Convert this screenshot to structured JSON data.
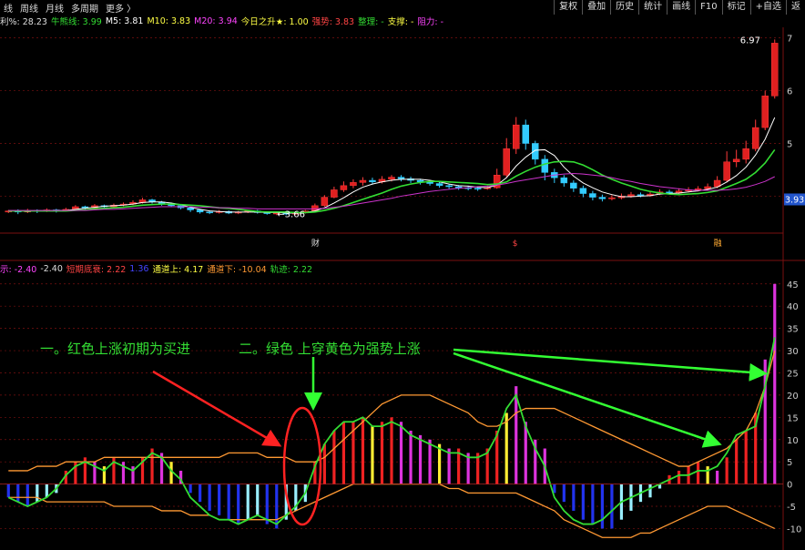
{
  "tabs": [
    "线",
    "周线",
    "月线",
    "多周期",
    "更多 〉"
  ],
  "toolbar": [
    "复权",
    "叠加",
    "历史",
    "统计",
    "画线",
    "F10",
    "标记",
    "+自选",
    "返"
  ],
  "info_main": [
    {
      "label": "利%: ",
      "value": "28.23",
      "color": "#dddddd"
    },
    {
      "label": "牛熊线: ",
      "value": "3.99",
      "color": "#33dd33"
    },
    {
      "label": "M5: ",
      "value": "3.81",
      "color": "#ffffff"
    },
    {
      "label": "M10: ",
      "value": "3.83",
      "color": "#ffff44"
    },
    {
      "label": "M20: ",
      "value": "3.94",
      "color": "#ff44ff"
    },
    {
      "label": "今日之升★: ",
      "value": "1.00",
      "color": "#ffff44"
    },
    {
      "label": "强势: ",
      "value": "3.83",
      "color": "#ff4444"
    },
    {
      "label": "整理: ",
      "value": "-",
      "color": "#33dd33"
    },
    {
      "label": "支撑: ",
      "value": "-",
      "color": "#ffff44"
    },
    {
      "label": "阻力: ",
      "value": "-",
      "color": "#ff44ff"
    }
  ],
  "info_sub": [
    {
      "label": "示: ",
      "value": "-2.40",
      "color": "#ff44ff"
    },
    {
      "label": "",
      "value": "-2.40",
      "color": "#dddddd"
    },
    {
      "label": "短期底衰: ",
      "value": "2.22",
      "color": "#ff4444"
    },
    {
      "label": "",
      "value": "1.36",
      "color": "#4444ff"
    },
    {
      "label": "通道上: ",
      "value": "4.17",
      "color": "#ffff44"
    },
    {
      "label": "通道下: ",
      "value": "-10.04",
      "color": "#ff9933"
    },
    {
      "label": "轨迹: ",
      "value": "2.22",
      "color": "#33dd33"
    }
  ],
  "annotations": {
    "buy_text": "一。红色上涨初期为买进",
    "strong_text": "二。绿色 上穿黄色为强势上涨",
    "low_label": "←3.66",
    "high_label": "6.97",
    "last_price": "3.93",
    "marker_cai": "财",
    "marker_mid": "$",
    "marker_right": "融"
  },
  "chart_data": [
    {
      "type": "candlestick",
      "title": "",
      "y_ticks": [
        "7",
        "6",
        "5",
        "4"
      ],
      "ylim": [
        3.3,
        7.2
      ],
      "grid": true,
      "candles": [
        [
          3.7,
          3.72,
          3.68,
          3.74
        ],
        [
          3.72,
          3.7,
          3.66,
          3.75
        ],
        [
          3.7,
          3.73,
          3.68,
          3.76
        ],
        [
          3.73,
          3.71,
          3.68,
          3.75
        ],
        [
          3.71,
          3.74,
          3.7,
          3.77
        ],
        [
          3.74,
          3.72,
          3.69,
          3.76
        ],
        [
          3.72,
          3.75,
          3.71,
          3.78
        ],
        [
          3.75,
          3.8,
          3.73,
          3.83
        ],
        [
          3.8,
          3.78,
          3.75,
          3.82
        ],
        [
          3.78,
          3.82,
          3.76,
          3.85
        ],
        [
          3.82,
          3.8,
          3.78,
          3.84
        ],
        [
          3.8,
          3.83,
          3.79,
          3.86
        ],
        [
          3.83,
          3.85,
          3.81,
          3.88
        ],
        [
          3.85,
          3.88,
          3.83,
          3.92
        ],
        [
          3.88,
          3.93,
          3.86,
          3.97
        ],
        [
          3.93,
          3.89,
          3.86,
          3.95
        ],
        [
          3.89,
          3.86,
          3.82,
          3.91
        ],
        [
          3.86,
          3.82,
          3.79,
          3.88
        ],
        [
          3.82,
          3.78,
          3.75,
          3.84
        ],
        [
          3.78,
          3.74,
          3.7,
          3.8
        ],
        [
          3.74,
          3.7,
          3.67,
          3.76
        ],
        [
          3.7,
          3.69,
          3.66,
          3.73
        ],
        [
          3.69,
          3.71,
          3.67,
          3.74
        ],
        [
          3.71,
          3.68,
          3.66,
          3.73
        ],
        [
          3.68,
          3.7,
          3.66,
          3.72
        ],
        [
          3.7,
          3.72,
          3.68,
          3.74
        ],
        [
          3.72,
          3.69,
          3.67,
          3.74
        ],
        [
          3.69,
          3.67,
          3.65,
          3.71
        ],
        [
          3.67,
          3.68,
          3.64,
          3.7
        ],
        [
          3.68,
          3.66,
          3.64,
          3.7
        ],
        [
          3.66,
          3.69,
          3.65,
          3.71
        ],
        [
          3.69,
          3.72,
          3.67,
          3.74
        ],
        [
          3.72,
          3.82,
          3.7,
          3.86
        ],
        [
          3.82,
          3.98,
          3.8,
          4.02
        ],
        [
          3.98,
          4.12,
          3.96,
          4.18
        ],
        [
          4.12,
          4.2,
          4.08,
          4.28
        ],
        [
          4.2,
          4.26,
          4.15,
          4.32
        ],
        [
          4.26,
          4.3,
          4.2,
          4.36
        ],
        [
          4.3,
          4.27,
          4.22,
          4.35
        ],
        [
          4.27,
          4.32,
          4.24,
          4.38
        ],
        [
          4.32,
          4.36,
          4.28,
          4.4
        ],
        [
          4.36,
          4.33,
          4.28,
          4.4
        ],
        [
          4.33,
          4.3,
          4.25,
          4.37
        ],
        [
          4.3,
          4.27,
          4.22,
          4.33
        ],
        [
          4.27,
          4.24,
          4.2,
          4.3
        ],
        [
          4.24,
          4.2,
          4.16,
          4.27
        ],
        [
          4.2,
          4.18,
          4.14,
          4.23
        ],
        [
          4.18,
          4.16,
          4.12,
          4.21
        ],
        [
          4.16,
          4.15,
          4.11,
          4.2
        ],
        [
          4.15,
          4.14,
          4.1,
          4.19
        ],
        [
          4.14,
          4.16,
          4.12,
          4.2
        ],
        [
          4.16,
          4.4,
          4.14,
          4.52
        ],
        [
          4.4,
          4.9,
          4.36,
          5.1
        ],
        [
          4.9,
          5.35,
          4.8,
          5.5
        ],
        [
          5.35,
          5.0,
          4.88,
          5.45
        ],
        [
          5.0,
          4.7,
          4.6,
          5.05
        ],
        [
          4.7,
          4.45,
          4.3,
          4.78
        ],
        [
          4.45,
          4.35,
          4.25,
          4.52
        ],
        [
          4.35,
          4.25,
          4.18,
          4.4
        ],
        [
          4.25,
          4.15,
          4.08,
          4.3
        ],
        [
          4.15,
          4.05,
          3.98,
          4.2
        ],
        [
          4.05,
          3.98,
          3.92,
          4.1
        ],
        [
          3.98,
          3.95,
          3.9,
          4.03
        ],
        [
          3.95,
          3.97,
          3.92,
          4.02
        ],
        [
          3.97,
          4.0,
          3.94,
          4.05
        ],
        [
          4.0,
          4.03,
          3.97,
          4.08
        ],
        [
          4.03,
          4.01,
          3.98,
          4.07
        ],
        [
          4.01,
          4.04,
          3.99,
          4.09
        ],
        [
          4.04,
          4.08,
          4.02,
          4.13
        ],
        [
          4.08,
          4.06,
          4.03,
          4.12
        ],
        [
          4.06,
          4.1,
          4.04,
          4.15
        ],
        [
          4.1,
          4.12,
          4.07,
          4.17
        ],
        [
          4.12,
          4.14,
          4.09,
          4.19
        ],
        [
          4.14,
          4.18,
          4.11,
          4.24
        ],
        [
          4.18,
          4.3,
          4.15,
          4.38
        ],
        [
          4.3,
          4.65,
          4.26,
          4.85
        ],
        [
          4.65,
          4.7,
          4.55,
          4.88
        ],
        [
          4.7,
          4.9,
          4.62,
          5.05
        ],
        [
          4.9,
          5.3,
          4.85,
          5.45
        ],
        [
          5.3,
          5.9,
          5.25,
          6.0
        ],
        [
          5.9,
          6.9,
          5.85,
          6.97
        ]
      ],
      "ma": {
        "M5": [
          3.72,
          3.72,
          3.71,
          3.72,
          3.72,
          3.73,
          3.73,
          3.75,
          3.77,
          3.79,
          3.81,
          3.82,
          3.83,
          3.85,
          3.88,
          3.89,
          3.89,
          3.87,
          3.84,
          3.79,
          3.75,
          3.72,
          3.71,
          3.7,
          3.7,
          3.7,
          3.7,
          3.69,
          3.69,
          3.68,
          3.68,
          3.69,
          3.72,
          3.78,
          3.87,
          3.97,
          4.08,
          4.17,
          4.23,
          4.27,
          4.3,
          4.32,
          4.32,
          4.32,
          4.3,
          4.27,
          4.23,
          4.2,
          4.19,
          4.17,
          4.16,
          4.21,
          4.35,
          4.57,
          4.74,
          4.87,
          4.88,
          4.77,
          4.55,
          4.38,
          4.25,
          4.16,
          4.08,
          4.03,
          3.99,
          3.99,
          4.0,
          4.01,
          4.04,
          4.05,
          4.06,
          4.08,
          4.1,
          4.13,
          4.17,
          4.27,
          4.39,
          4.55,
          4.78,
          5.08,
          5.49
        ],
        "M10": [
          3.72,
          3.72,
          3.72,
          3.72,
          3.72,
          3.72,
          3.72,
          3.73,
          3.74,
          3.76,
          3.77,
          3.78,
          3.79,
          3.81,
          3.83,
          3.84,
          3.85,
          3.85,
          3.84,
          3.83,
          3.82,
          3.8,
          3.78,
          3.77,
          3.75,
          3.73,
          3.71,
          3.7,
          3.7,
          3.7,
          3.69,
          3.69,
          3.7,
          3.73,
          3.77,
          3.82,
          3.88,
          3.94,
          4.0,
          4.06,
          4.13,
          4.19,
          4.23,
          4.26,
          4.28,
          4.28,
          4.27,
          4.26,
          4.25,
          4.24,
          4.22,
          4.23,
          4.27,
          4.38,
          4.47,
          4.55,
          4.61,
          4.65,
          4.66,
          4.65,
          4.59,
          4.5,
          4.4,
          4.32,
          4.25,
          4.19,
          4.13,
          4.09,
          4.06,
          4.04,
          4.03,
          4.04,
          4.05,
          4.07,
          4.1,
          4.17,
          4.24,
          4.32,
          4.45,
          4.63,
          4.88
        ],
        "M20": [
          3.73,
          3.73,
          3.73,
          3.73,
          3.73,
          3.73,
          3.73,
          3.73,
          3.73,
          3.74,
          3.75,
          3.75,
          3.76,
          3.77,
          3.78,
          3.79,
          3.8,
          3.8,
          3.8,
          3.8,
          3.79,
          3.79,
          3.78,
          3.78,
          3.77,
          3.77,
          3.76,
          3.76,
          3.76,
          3.76,
          3.76,
          3.76,
          3.76,
          3.77,
          3.79,
          3.81,
          3.84,
          3.87,
          3.9,
          3.93,
          3.96,
          4.0,
          4.03,
          4.06,
          4.09,
          4.11,
          4.13,
          4.15,
          4.16,
          4.18,
          4.19,
          4.21,
          4.24,
          4.28,
          4.31,
          4.34,
          4.37,
          4.4,
          4.42,
          4.43,
          4.42,
          4.4,
          4.38,
          4.35,
          4.31,
          4.28,
          4.24,
          4.21,
          4.18,
          4.16,
          4.14,
          4.12,
          4.11,
          4.11,
          4.11,
          4.12,
          4.14,
          4.17,
          4.22,
          4.28,
          4.37
        ]
      }
    },
    {
      "type": "bar",
      "title": "",
      "y_ticks": [
        "45",
        "40",
        "35",
        "30",
        "25",
        "20",
        "15",
        "10",
        "5",
        "0",
        "-5",
        "-10"
      ],
      "ylim": [
        -14,
        47
      ],
      "grid": true,
      "values": [
        -3,
        -4,
        -5,
        -4,
        -3,
        -2,
        3,
        5,
        6,
        5,
        4,
        6,
        5,
        4,
        6,
        8,
        7,
        5,
        3,
        -2,
        -4,
        -6,
        -7,
        -8,
        -9,
        -8,
        -7,
        -9,
        -10,
        -8,
        -6,
        -4,
        5,
        9,
        12,
        14,
        14,
        15,
        13,
        14,
        15,
        14,
        12,
        11,
        10,
        9,
        8,
        8,
        7,
        7,
        8,
        12,
        16,
        22,
        14,
        10,
        8,
        -2,
        -4,
        -6,
        -8,
        -9,
        -10,
        -10,
        -8,
        -6,
        -4,
        -3,
        -1,
        2,
        3,
        4,
        5,
        4,
        3,
        6,
        10,
        12,
        16,
        28,
        45
      ],
      "channel_upper": [
        3,
        3,
        3,
        4,
        4,
        4,
        5,
        5,
        5,
        5,
        6,
        6,
        6,
        6,
        6,
        6,
        6,
        6,
        6,
        6,
        6,
        6,
        6,
        7,
        7,
        7,
        7,
        6,
        6,
        6,
        5,
        5,
        5,
        6,
        8,
        10,
        12,
        14,
        16,
        18,
        19,
        20,
        20,
        20,
        20,
        19,
        18,
        17,
        16,
        14,
        13,
        13,
        14,
        16,
        17,
        17,
        17,
        17,
        16,
        15,
        14,
        13,
        12,
        11,
        10,
        9,
        8,
        7,
        6,
        5,
        4,
        4,
        5,
        6,
        7,
        8,
        10,
        12,
        16,
        22,
        30
      ],
      "channel_lower": [
        -3,
        -3,
        -3,
        -3,
        -4,
        -4,
        -4,
        -4,
        -4,
        -4,
        -4,
        -5,
        -5,
        -5,
        -5,
        -5,
        -6,
        -6,
        -6,
        -7,
        -7,
        -7,
        -8,
        -8,
        -8,
        -8,
        -8,
        -8,
        -8,
        -7,
        -6,
        -5,
        -4,
        -3,
        -2,
        -1,
        0,
        0,
        0,
        0,
        0,
        0,
        0,
        0,
        0,
        0,
        -1,
        -1,
        -2,
        -2,
        -2,
        -2,
        -2,
        -2,
        -3,
        -4,
        -5,
        -6,
        -8,
        -9,
        -10,
        -11,
        -12,
        -12,
        -12,
        -12,
        -11,
        -11,
        -10,
        -9,
        -8,
        -7,
        -6,
        -5,
        -5,
        -5,
        -6,
        -7,
        -8,
        -9,
        -10
      ],
      "track": [
        -3,
        -4,
        -5,
        -4,
        -3,
        -1,
        2,
        4,
        5,
        4,
        3,
        5,
        4,
        3,
        5,
        7,
        6,
        3,
        1,
        -3,
        -5,
        -7,
        -8,
        -8,
        -9,
        -8,
        -7,
        -8,
        -9,
        -7,
        -5,
        -2,
        4,
        9,
        12,
        14,
        14,
        15,
        13,
        13,
        14,
        13,
        11,
        10,
        9,
        8,
        7,
        7,
        6,
        6,
        7,
        11,
        17,
        20,
        13,
        8,
        4,
        -3,
        -6,
        -8,
        -9,
        -9,
        -8,
        -6,
        -4,
        -3,
        -2,
        -1,
        0,
        1,
        2,
        2,
        3,
        3,
        4,
        7,
        11,
        12,
        13,
        22,
        33
      ]
    }
  ]
}
